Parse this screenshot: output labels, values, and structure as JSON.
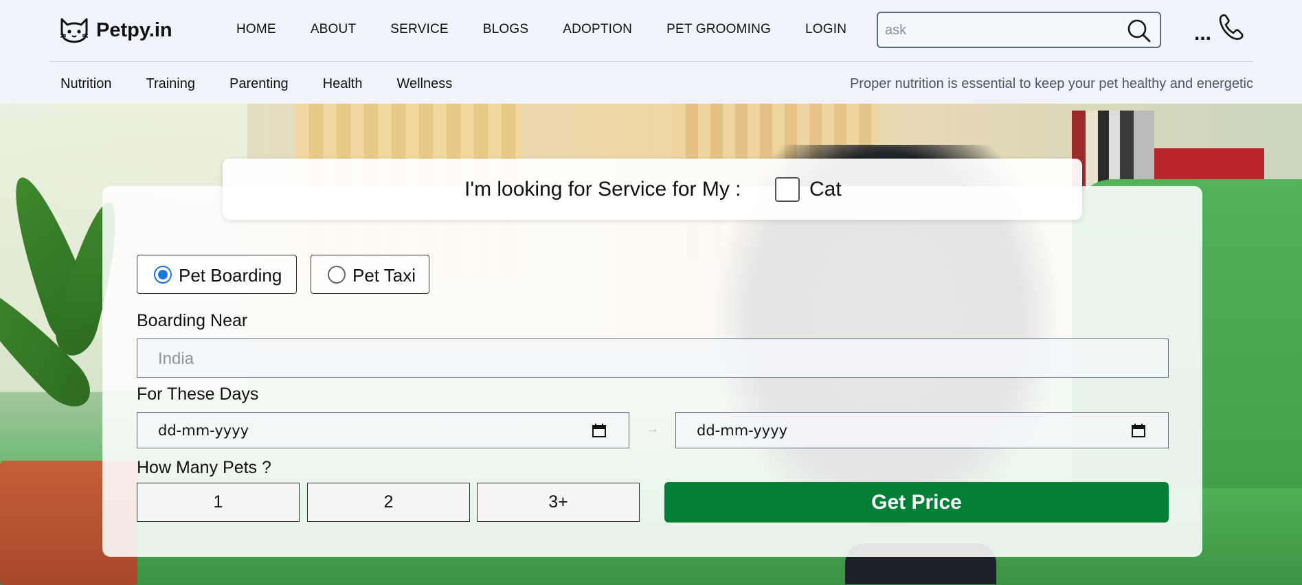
{
  "header": {
    "logo_text": "Petpy.in",
    "nav": [
      "HOME",
      "ABOUT",
      "SERVICE",
      "BLOGS",
      "ADOPTION",
      "PET GROOMING",
      "LOGIN"
    ],
    "search_placeholder": "ask",
    "more_label": "...",
    "subnav": [
      "Nutrition",
      "Training",
      "Parenting",
      "Health",
      "Wellness"
    ],
    "tagline": "Proper nutrition is essential to keep your pet healthy and energetic"
  },
  "form": {
    "pet_prompt": "I'm looking for Service for My :",
    "pet_option": "Cat",
    "services": [
      {
        "label": "Pet Boarding",
        "selected": true
      },
      {
        "label": "Pet Taxi",
        "selected": false
      }
    ],
    "boarding_label": "Boarding Near",
    "boarding_placeholder": "India",
    "days_label": "For These Days",
    "date_from": "dd-mm-yyyy",
    "date_to": "dd-mm-yyyy",
    "arrow": "→",
    "pets_label": "How Many Pets ?",
    "pet_counts": [
      "1",
      "2",
      "3+"
    ],
    "submit_label": "Get Price"
  },
  "colors": {
    "accent": "#017f37",
    "radio": "#1a73e8",
    "header_bg": "#f0f4fa"
  }
}
